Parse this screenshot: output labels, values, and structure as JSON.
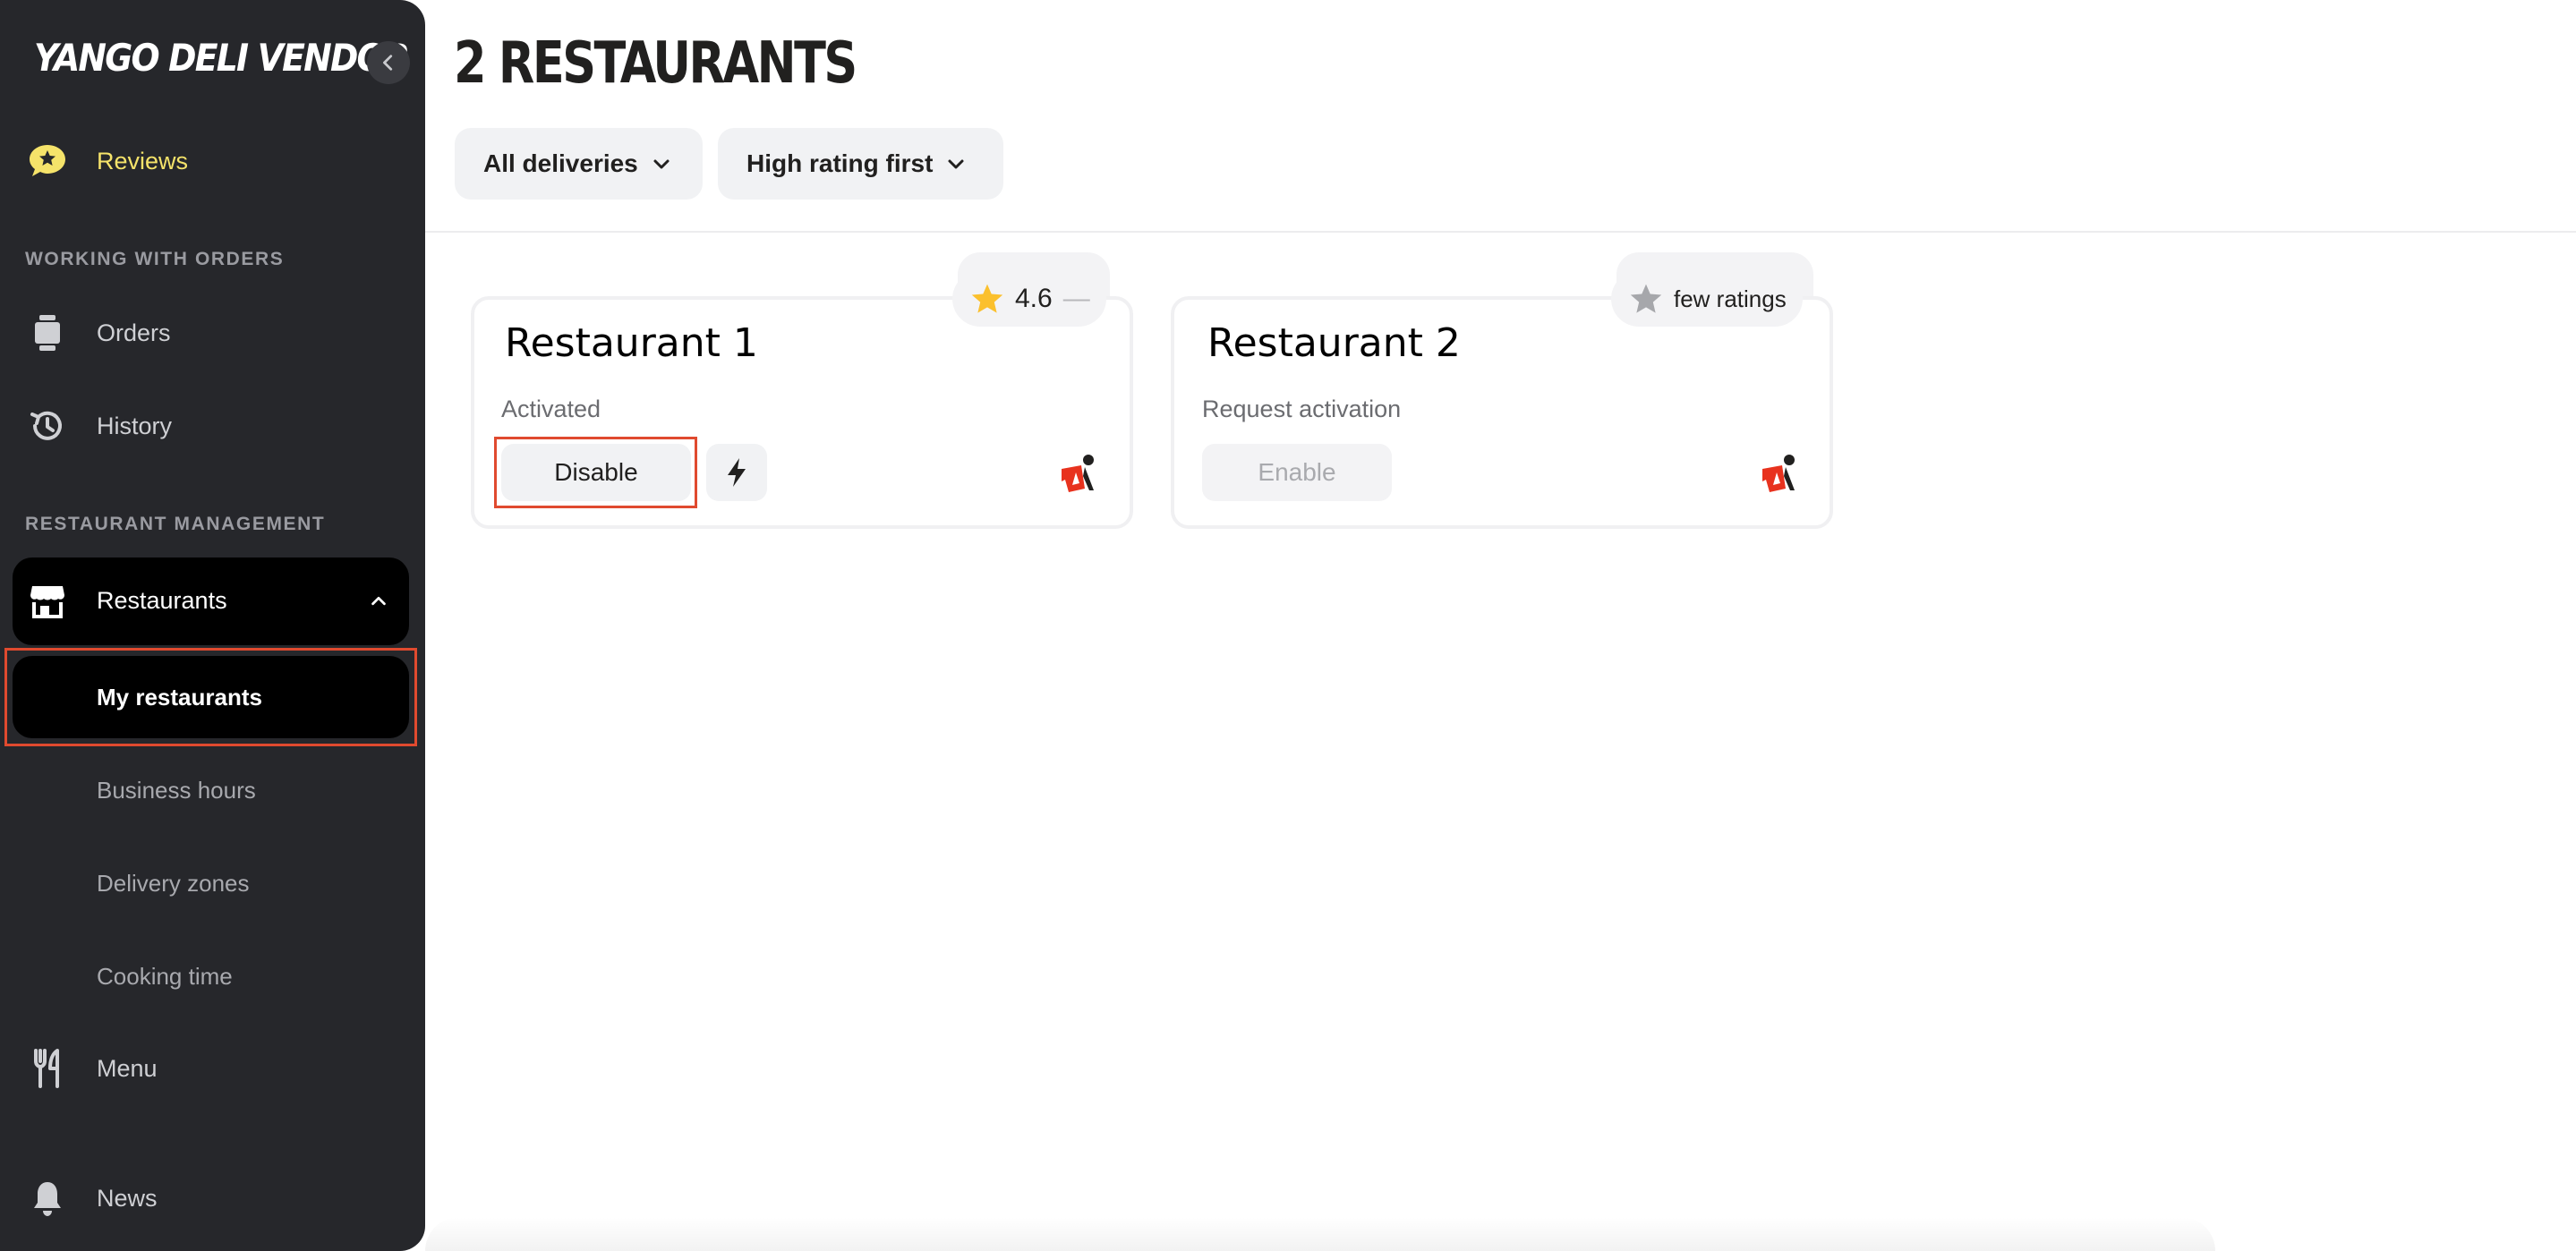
{
  "app": {
    "logo_text": "YANGO DELI VENDOR"
  },
  "sidebar": {
    "reviews_label": "Reviews",
    "section_orders": "WORKING WITH ORDERS",
    "orders_label": "Orders",
    "history_label": "History",
    "section_management": "RESTAURANT MANAGEMENT",
    "restaurants_label": "Restaurants",
    "sub_items": [
      {
        "label": "My restaurants"
      },
      {
        "label": "Business hours"
      },
      {
        "label": "Delivery zones"
      },
      {
        "label": "Cooking time"
      }
    ],
    "menu_label": "Menu",
    "news_label": "News"
  },
  "main": {
    "title": "2 RESTAURANTS",
    "filters": {
      "delivery": "All deliveries",
      "sort": "High rating first"
    },
    "cards": [
      {
        "name": "Restaurant  1",
        "rating": "4.6",
        "rating_dash": "—",
        "status": "Activated",
        "button": "Disable"
      },
      {
        "name": "Restaurant  2",
        "rating": "few ratings",
        "status": "Request activation",
        "button": "Enable"
      }
    ]
  },
  "colors": {
    "sidebar_bg": "#26272b",
    "accent_yellow": "#f5e36a",
    "star_yellow": "#fbc02d",
    "highlight_red": "#e04a2f",
    "courier_red": "#e8321e"
  }
}
